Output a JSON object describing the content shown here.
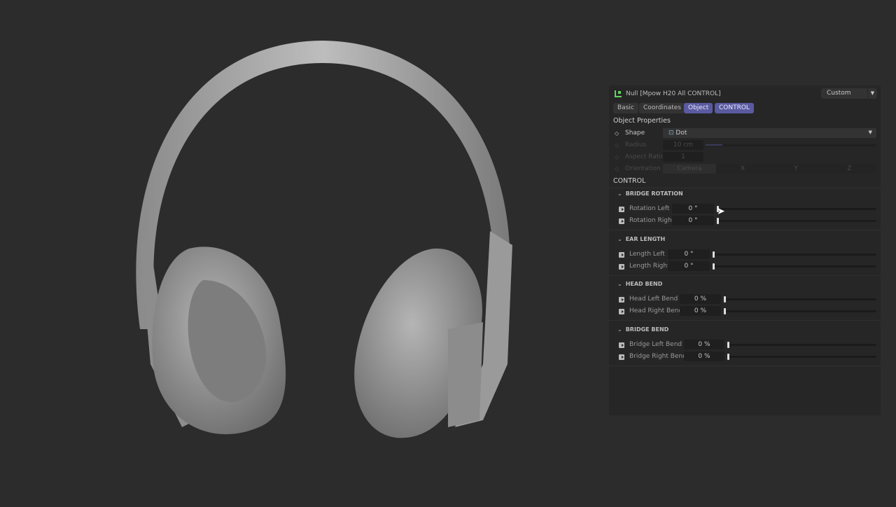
{
  "header": {
    "title": "Null [Mpow H20 All CONTROL]",
    "preset": "Custom"
  },
  "tabs": [
    {
      "label": "Basic",
      "active": false
    },
    {
      "label": "Coordinates",
      "active": false
    },
    {
      "label": "Object",
      "active": true
    },
    {
      "label": "CONTROL",
      "active": true
    }
  ],
  "object_properties": {
    "heading": "Object Properties",
    "shape": {
      "label": "Shape",
      "value": "Dot"
    },
    "radius": {
      "label": "Radius",
      "value": "10 cm"
    },
    "aspect": {
      "label": "Aspect Ratio",
      "value": "1"
    },
    "orientation": {
      "label": "Orientation",
      "options": [
        "Camera",
        "X",
        "Y",
        "Z"
      ]
    }
  },
  "control": {
    "heading": "CONTROL",
    "groups": [
      {
        "title": "BRIDGE ROTATION",
        "rows": [
          {
            "label": "Rotation Left",
            "value": "0 °",
            "slider": 0
          },
          {
            "label": "Rotation Right",
            "value": "0 °",
            "slider": 0
          }
        ]
      },
      {
        "title": "EAR LENGTH",
        "rows": [
          {
            "label": "Length Left",
            "value": "0 °",
            "slider": 0
          },
          {
            "label": "Length Right",
            "value": "0 °",
            "slider": 0
          }
        ]
      },
      {
        "title": "HEAD BEND",
        "rows": [
          {
            "label": "Head Left Bend",
            "value": "0 %",
            "slider": 0
          },
          {
            "label": "Head Right Bend",
            "value": "0 %",
            "slider": 0
          }
        ]
      },
      {
        "title": "BRIDGE BEND",
        "rows": [
          {
            "label": "Bridge Left Bend",
            "value": "0 %",
            "slider": 0
          },
          {
            "label": "Bridge Right Bend",
            "value": "0 %",
            "slider": 0
          }
        ]
      }
    ]
  }
}
